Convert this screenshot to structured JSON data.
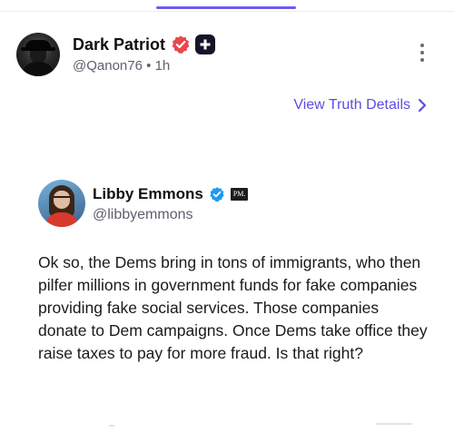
{
  "post": {
    "author": {
      "display_name": "Dark Patriot",
      "handle": "@Qanon76",
      "separator": "•",
      "age": "1h",
      "badges": [
        "verified-badge-icon",
        "plus-badge-icon"
      ]
    },
    "view_details_label": "View Truth Details",
    "quoted": {
      "display_name": "Libby Emmons",
      "handle": "@libbyemmons",
      "affiliate_badge": "PM.",
      "body": "Ok so, the Dems bring in tons of immigrants, who then pilfer millions in government funds for fake companies providing fake social services. Those companies donate to Dem campaigns. Once Dems take office they raise taxes to pay for more fraud. Is that right?"
    }
  },
  "colors": {
    "accent": "#5a4fe0",
    "verified_red": "#e8474d",
    "verified_blue": "#1d9bf0",
    "secondary_text": "#5f5f6e"
  }
}
